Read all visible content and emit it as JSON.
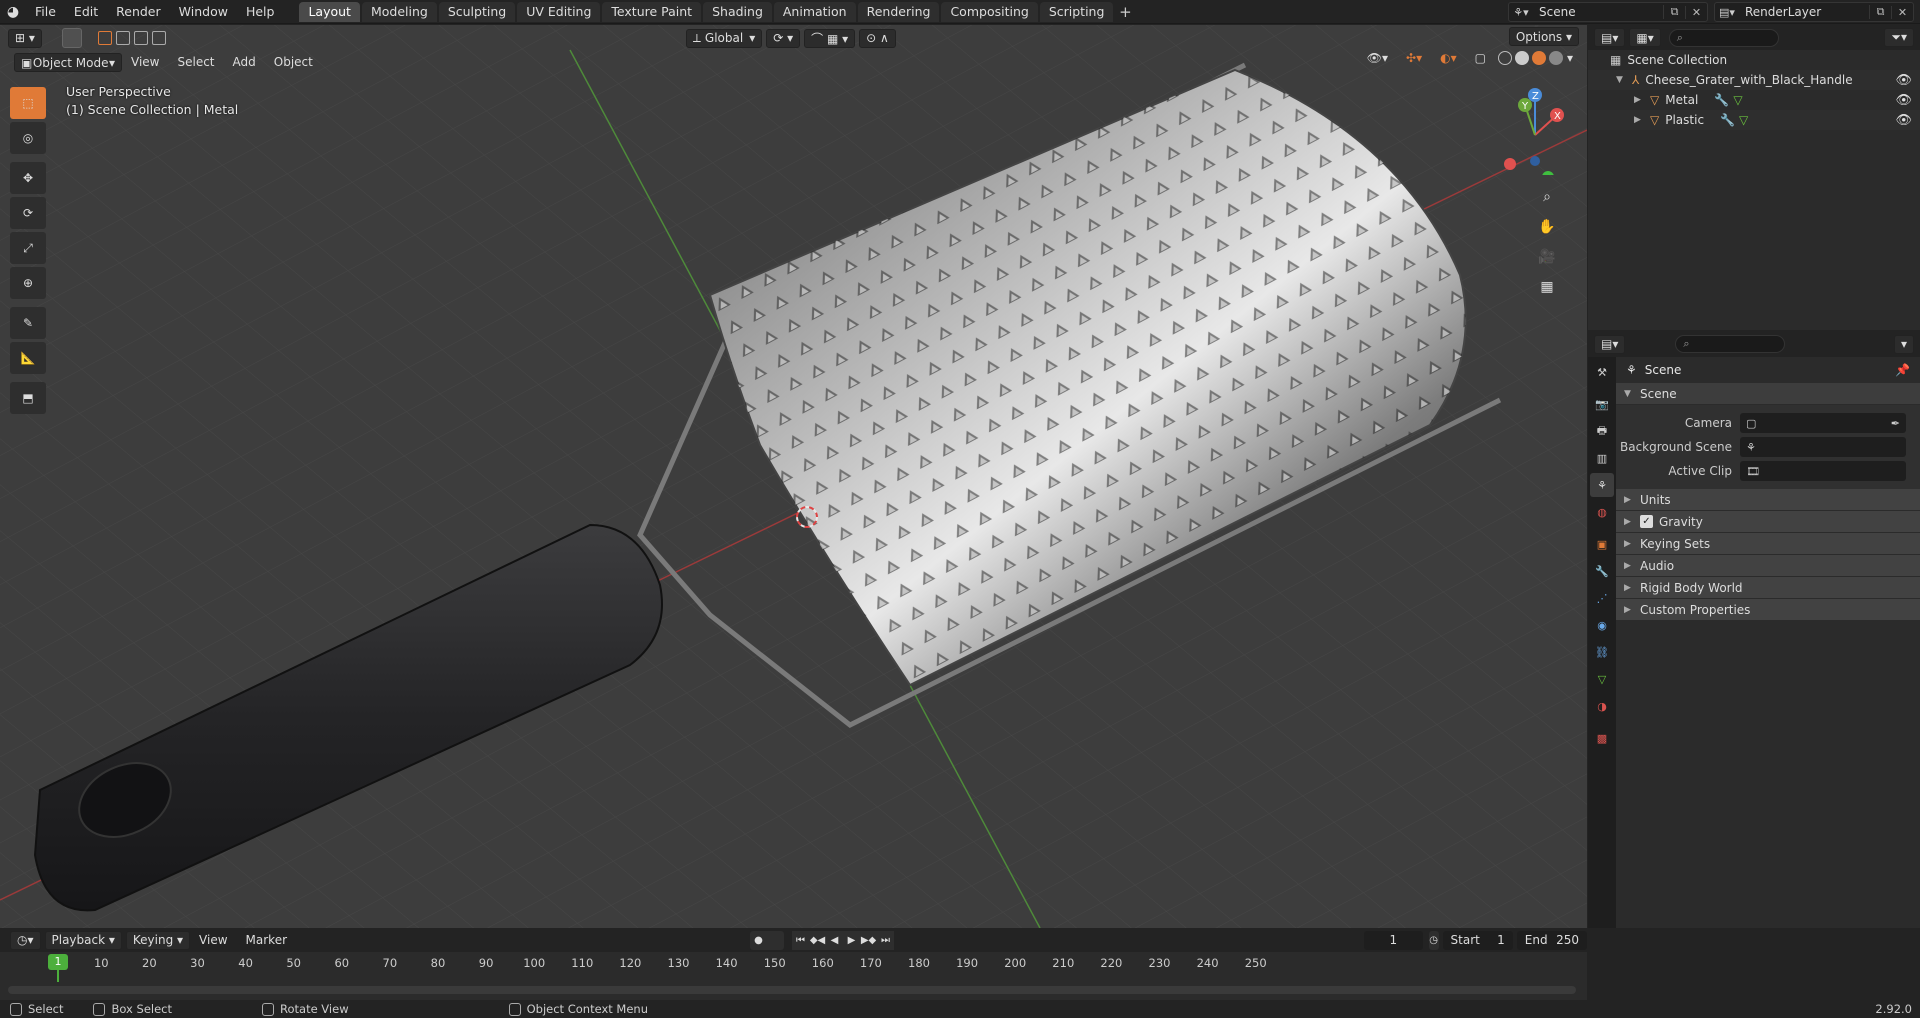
{
  "topbar": {
    "menu": [
      "File",
      "Edit",
      "Render",
      "Window",
      "Help"
    ],
    "workspaces": [
      "Layout",
      "Modeling",
      "Sculpting",
      "UV Editing",
      "Texture Paint",
      "Shading",
      "Animation",
      "Rendering",
      "Compositing",
      "Scripting"
    ],
    "active_workspace": "Layout",
    "scene_name": "Scene",
    "view_layer": "RenderLayer"
  },
  "viewport": {
    "mode": "Object Mode",
    "menus": [
      "View",
      "Select",
      "Add",
      "Object"
    ],
    "orientation": "Global",
    "options_label": "Options",
    "overlay_line1": "User Perspective",
    "overlay_line2": "(1) Scene Collection | Metal",
    "gizmo_axes": {
      "x": "X",
      "y": "Y",
      "z": "Z"
    },
    "colors": {
      "x_axis": "#e0514f",
      "y_axis": "#6ca83b",
      "z_axis": "#4a8cd9",
      "active_tool": "#e07a37"
    }
  },
  "outliner": {
    "root": "Scene Collection",
    "collection": "Cheese_Grater_with_Black_Handle",
    "objects": [
      "Metal",
      "Plastic"
    ]
  },
  "properties": {
    "context": "Scene",
    "panel_title": "Scene",
    "fields": {
      "camera_label": "Camera",
      "background_label": "Background Scene",
      "clip_label": "Active Clip"
    },
    "subpanels": [
      "Units",
      "Gravity",
      "Keying Sets",
      "Audio",
      "Rigid Body World",
      "Custom Properties"
    ],
    "gravity_checked": true
  },
  "timeline": {
    "menus": [
      "Playback",
      "Keying",
      "View",
      "Marker"
    ],
    "current_frame": "1",
    "start_label": "Start",
    "start": "1",
    "end_label": "End",
    "end": "250",
    "ticks": [
      "1",
      "10",
      "20",
      "30",
      "40",
      "50",
      "60",
      "70",
      "80",
      "90",
      "100",
      "110",
      "120",
      "130",
      "140",
      "150",
      "160",
      "170",
      "180",
      "190",
      "200",
      "210",
      "220",
      "230",
      "240",
      "250"
    ]
  },
  "statusbar": {
    "select": "Select",
    "box_select": "Box Select",
    "rotate": "Rotate View",
    "context_menu": "Object Context Menu",
    "version": "2.92.0"
  }
}
